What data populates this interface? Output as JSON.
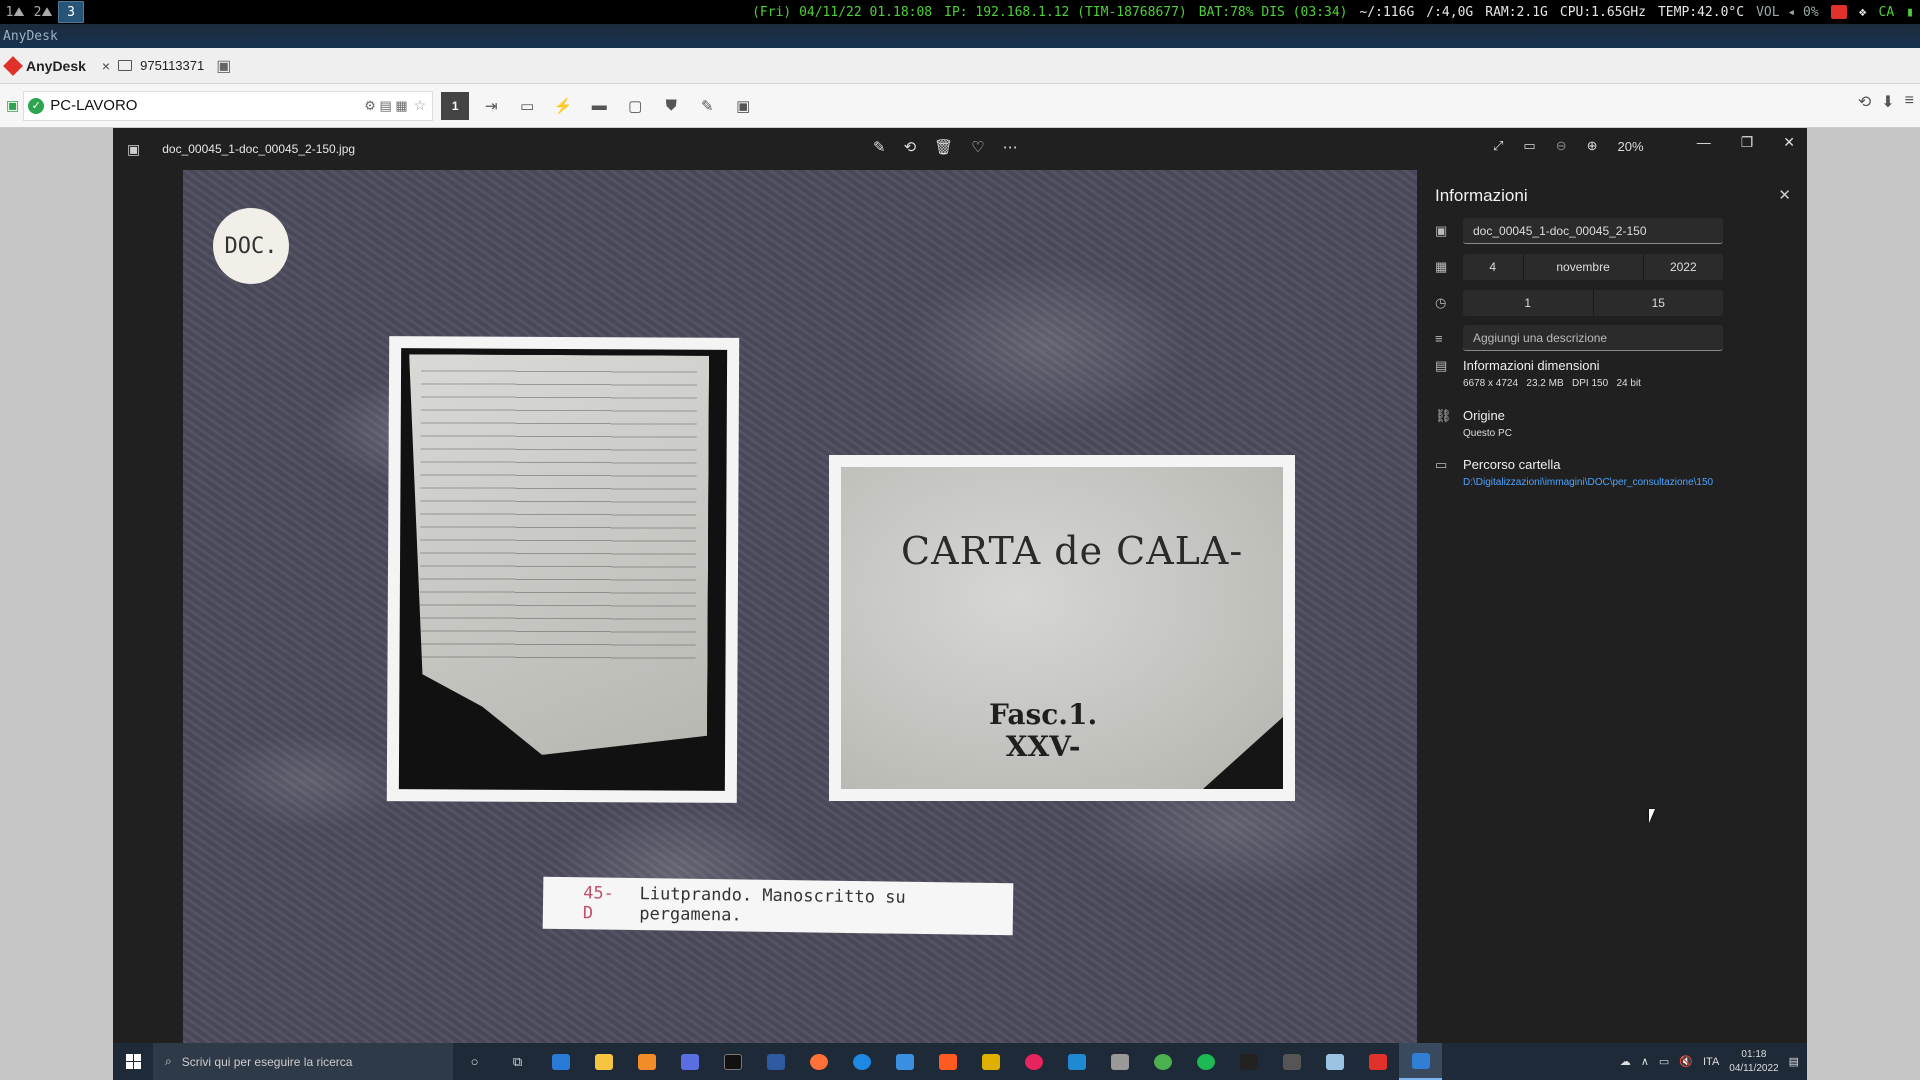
{
  "topbar": {
    "workspaces": [
      "1",
      "2",
      "3"
    ],
    "status": {
      "datetime": "(Fri) 04/11/22 01.18:08",
      "ip": "IP: 192.168.1.12 (TIM-18768677)",
      "battery": "BAT:78% DIS (03:34)",
      "disk_home": "~/:116G",
      "disk_root": "/:4,0G",
      "ram": "RAM:2.1G",
      "cpu": "CPU:1.65GHz",
      "temp": "TEMP:42.0°C",
      "vol": "VOL",
      "vol_level": "0%",
      "tray_ca": "CA"
    }
  },
  "anydesk": {
    "window_title": "AnyDesk",
    "logo_label": "AnyDesk",
    "tab_close": "×",
    "session_id": "975113371",
    "address": "PC-LAVORO",
    "monitor_number": "1"
  },
  "photos": {
    "filename": "doc_00045_1-doc_00045_2-150.jpg",
    "zoom": "20%",
    "toolbar_icons": [
      "edit-icon",
      "rotate-icon",
      "delete-icon",
      "favorite-icon",
      "more-icon"
    ],
    "image": {
      "badge": "DOC.",
      "carta_text": "CARTA de CALA-",
      "fasc_line1": "Fasc.1.",
      "fasc_line2": "XXV-",
      "caption_num": "45-D",
      "caption_text": "Liutprando. Manoscritto su pergamena."
    }
  },
  "info": {
    "title": "Informazioni",
    "name_field": "doc_00045_1-doc_00045_2-150",
    "date": {
      "day": "4",
      "month": "novembre",
      "year": "2022"
    },
    "time": {
      "hour": "1",
      "minute": "15"
    },
    "description_placeholder": "Aggiungi una descrizione",
    "dimensions_title": "Informazioni dimensioni",
    "dimensions": [
      "6678 x 4724",
      "23.2 MB",
      "DPI 150",
      "24 bit"
    ],
    "origin_title": "Origine",
    "origin_value": "Questo PC",
    "path_title": "Percorso cartella",
    "path_value": "D:\\Digitalizzazioni\\immagini\\DOC\\per_consultazione\\150"
  },
  "taskbar": {
    "search_placeholder": "Scrivi qui per eseguire la ricerca",
    "lang": "ITA",
    "time": "01:18",
    "date": "04/11/2022"
  },
  "colors": {
    "accent_blue": "#285577",
    "status_green": "#4cd137",
    "link_blue": "#4da3ff",
    "anydesk_red": "#e0312b"
  }
}
